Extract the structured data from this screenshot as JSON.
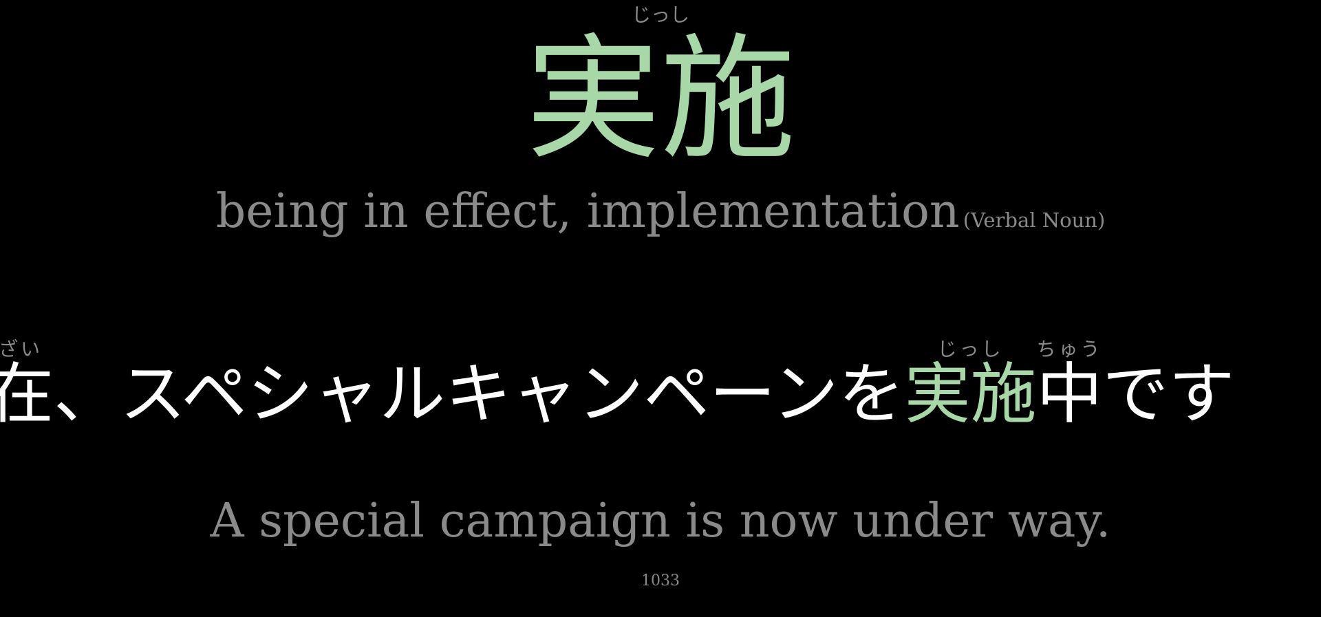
{
  "headword": {
    "reading": "じっし",
    "word": "実施",
    "definition": "being in effect, implementation",
    "part_of_speech": "(Verbal Noun)"
  },
  "example": {
    "segments": [
      {
        "text": "在",
        "reading": "ざい",
        "highlight": false
      },
      {
        "text": "、スペシャルキャンペーンを",
        "reading": "",
        "highlight": false
      },
      {
        "text": "実施",
        "reading": "じっし",
        "highlight": true
      },
      {
        "text": "中",
        "reading": "ちゅう",
        "highlight": false
      },
      {
        "text": "です",
        "reading": "",
        "highlight": false
      }
    ],
    "translation": "A special campaign is now under way."
  },
  "card_number": "1033",
  "colors": {
    "background": "#000000",
    "accent": "#a8d8a8",
    "muted": "#8a8a8a",
    "text": "#ffffff"
  }
}
